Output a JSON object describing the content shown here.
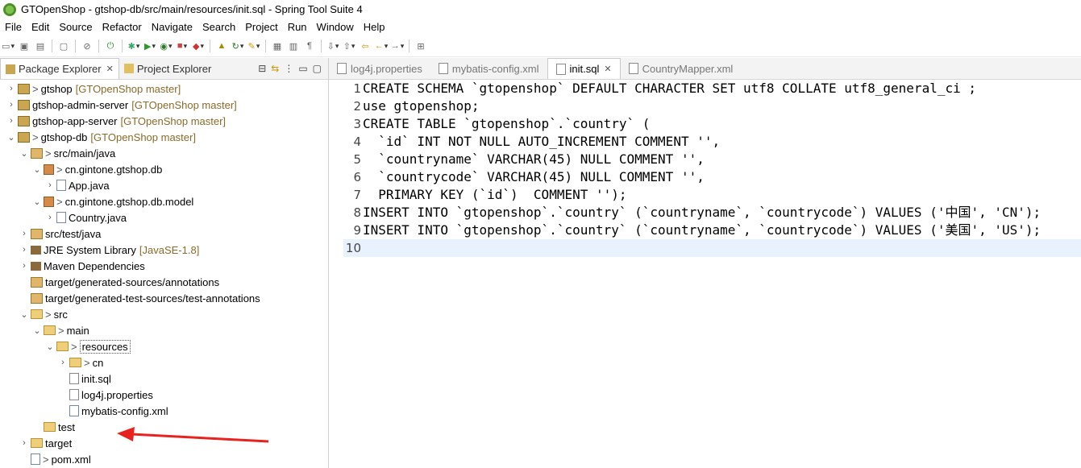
{
  "window": {
    "title": "GTOpenShop - gtshop-db/src/main/resources/init.sql - Spring Tool Suite 4"
  },
  "menu": [
    "File",
    "Edit",
    "Source",
    "Refactor",
    "Navigate",
    "Search",
    "Project",
    "Run",
    "Window",
    "Help"
  ],
  "left_tabs": [
    {
      "label": "Package Explorer",
      "close": "✕"
    },
    {
      "label": "Project Explorer"
    }
  ],
  "tree": [
    {
      "indent": 0,
      "twisty": ">",
      "icon": "project-icon",
      "dec": ">",
      "label": "gtshop",
      "extra": "[GTOpenShop master]"
    },
    {
      "indent": 0,
      "twisty": ">",
      "icon": "project-icon",
      "dec": "",
      "label": "gtshop-admin-server",
      "extra": "[GTOpenShop master]"
    },
    {
      "indent": 0,
      "twisty": ">",
      "icon": "project-icon",
      "dec": "",
      "label": "gtshop-app-server",
      "extra": "[GTOpenShop master]"
    },
    {
      "indent": 0,
      "twisty": "v",
      "icon": "project-icon",
      "dec": ">",
      "label": "gtshop-db",
      "extra": "[GTOpenShop master]"
    },
    {
      "indent": 1,
      "twisty": "v",
      "icon": "source-folder-icon",
      "dec": ">",
      "label": "src/main/java",
      "extra": ""
    },
    {
      "indent": 2,
      "twisty": "v",
      "icon": "package-icon",
      "dec": ">",
      "label": "cn.gintone.gtshop.db",
      "extra": ""
    },
    {
      "indent": 3,
      "twisty": ">",
      "icon": "java-file-icon",
      "dec": "",
      "label": "App.java",
      "extra": ""
    },
    {
      "indent": 2,
      "twisty": "v",
      "icon": "package-icon",
      "dec": ">",
      "label": "cn.gintone.gtshop.db.model",
      "extra": ""
    },
    {
      "indent": 3,
      "twisty": ">",
      "icon": "java-file-icon",
      "dec": "",
      "label": "Country.java",
      "extra": ""
    },
    {
      "indent": 1,
      "twisty": ">",
      "icon": "source-folder-icon",
      "dec": "",
      "label": "src/test/java",
      "extra": ""
    },
    {
      "indent": 1,
      "twisty": ">",
      "icon": "library-icon",
      "dec": "",
      "label": "JRE System Library",
      "extra": "[JavaSE-1.8]"
    },
    {
      "indent": 1,
      "twisty": ">",
      "icon": "library-icon",
      "dec": "",
      "label": "Maven Dependencies",
      "extra": ""
    },
    {
      "indent": 1,
      "twisty": "",
      "icon": "source-folder-icon",
      "dec": "",
      "label": "target/generated-sources/annotations",
      "extra": ""
    },
    {
      "indent": 1,
      "twisty": "",
      "icon": "source-folder-icon",
      "dec": "",
      "label": "target/generated-test-sources/test-annotations",
      "extra": ""
    },
    {
      "indent": 1,
      "twisty": "v",
      "icon": "folder-icon",
      "dec": ">",
      "label": "src",
      "extra": ""
    },
    {
      "indent": 2,
      "twisty": "v",
      "icon": "folder-icon",
      "dec": ">",
      "label": "main",
      "extra": ""
    },
    {
      "indent": 3,
      "twisty": "v",
      "icon": "folder-icon",
      "dec": ">",
      "label": "resources",
      "extra": "",
      "selected": true
    },
    {
      "indent": 4,
      "twisty": ">",
      "icon": "folder-icon",
      "dec": ">",
      "label": "cn",
      "extra": ""
    },
    {
      "indent": 4,
      "twisty": "",
      "icon": "sql-file-icon",
      "dec": "",
      "label": "init.sql",
      "extra": ""
    },
    {
      "indent": 4,
      "twisty": "",
      "icon": "properties-file-icon",
      "dec": "",
      "label": "log4j.properties",
      "extra": ""
    },
    {
      "indent": 4,
      "twisty": "",
      "icon": "xml-file-icon",
      "dec": "",
      "label": "mybatis-config.xml",
      "extra": ""
    },
    {
      "indent": 2,
      "twisty": "",
      "icon": "folder-icon",
      "dec": "",
      "label": "test",
      "extra": ""
    },
    {
      "indent": 1,
      "twisty": ">",
      "icon": "folder-icon",
      "dec": "",
      "label": "target",
      "extra": ""
    },
    {
      "indent": 1,
      "twisty": "",
      "icon": "xml-file-icon",
      "dec": ">",
      "label": "pom.xml",
      "extra": ""
    }
  ],
  "editor_tabs": [
    {
      "label": "log4j.properties",
      "active": false
    },
    {
      "label": "mybatis-config.xml",
      "active": false
    },
    {
      "label": "init.sql",
      "active": true,
      "close": "✕"
    },
    {
      "label": "CountryMapper.xml",
      "active": false
    }
  ],
  "code_lines": [
    {
      "n": "1",
      "text": "CREATE SCHEMA `gtopenshop` DEFAULT CHARACTER SET utf8 COLLATE utf8_general_ci ;"
    },
    {
      "n": "2",
      "text": "use gtopenshop;"
    },
    {
      "n": "3",
      "text": "CREATE TABLE `gtopenshop`.`country` ("
    },
    {
      "n": "4",
      "text": "  `id` INT NOT NULL AUTO_INCREMENT COMMENT '',"
    },
    {
      "n": "5",
      "text": "  `countryname` VARCHAR(45) NULL COMMENT '',"
    },
    {
      "n": "6",
      "text": "  `countrycode` VARCHAR(45) NULL COMMENT '',"
    },
    {
      "n": "7",
      "text": "  PRIMARY KEY (`id`)  COMMENT '');"
    },
    {
      "n": "8",
      "text": "INSERT INTO `gtopenshop`.`country` (`countryname`, `countrycode`) VALUES ('中国', 'CN');"
    },
    {
      "n": "9",
      "text": "INSERT INTO `gtopenshop`.`country` (`countryname`, `countrycode`) VALUES ('美国', 'US');"
    },
    {
      "n": "10",
      "text": ""
    }
  ],
  "colors": {
    "current_line": "#e8f2fe",
    "annotation_arrow": "#e8231f",
    "decoration_text": "#8a6a2a"
  }
}
